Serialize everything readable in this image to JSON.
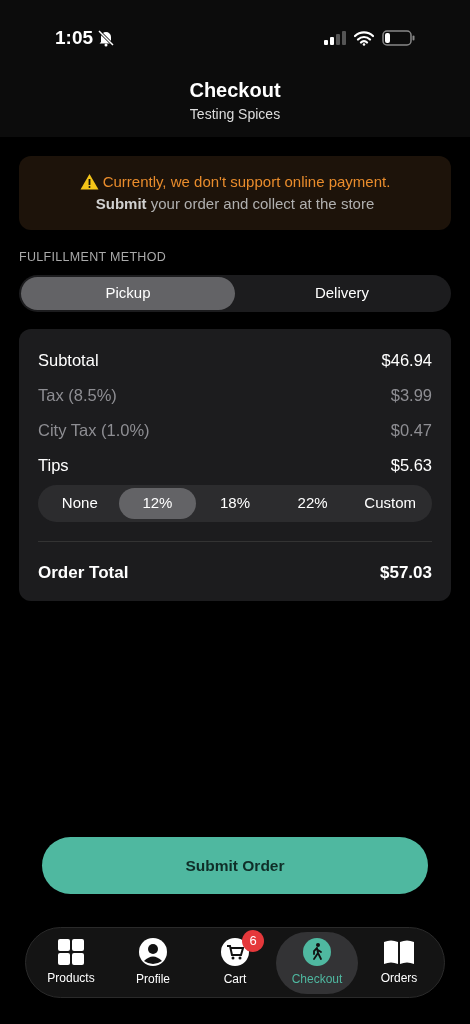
{
  "status_bar": {
    "time": "1:05",
    "silent": true
  },
  "header": {
    "title": "Checkout",
    "subtitle": "Testing Spices"
  },
  "notice": {
    "headline": "Currently, we don't support online payment.",
    "detail": "**Submit** your order and collect at the store"
  },
  "fulfillment": {
    "label": "FULFILLMENT METHOD",
    "options": [
      {
        "label": "Pickup",
        "selected": true
      },
      {
        "label": "Delivery",
        "selected": false
      }
    ]
  },
  "summary": {
    "rows": [
      {
        "label": "Subtotal",
        "value": "$46.94",
        "muted": false
      },
      {
        "label": "Tax (8.5%)",
        "value": "$3.99",
        "muted": true
      },
      {
        "label": "City Tax (1.0%)",
        "value": "$0.47",
        "muted": true
      },
      {
        "label": "Tips",
        "value": "$5.63",
        "muted": false
      }
    ],
    "tip_options": [
      {
        "label": "None",
        "selected": false
      },
      {
        "label": "12%",
        "selected": true
      },
      {
        "label": "18%",
        "selected": false
      },
      {
        "label": "22%",
        "selected": false
      },
      {
        "label": "Custom",
        "selected": false
      }
    ],
    "total": {
      "label": "Order Total",
      "value": "$57.03"
    }
  },
  "submit_button": "Submit Order",
  "tab_bar": [
    {
      "kind": "grid",
      "label": "Products",
      "selected": false
    },
    {
      "kind": "person",
      "label": "Profile",
      "selected": false
    },
    {
      "kind": "cart",
      "label": "Cart",
      "selected": false,
      "badge": "6"
    },
    {
      "kind": "walk",
      "label": "Checkout",
      "selected": true
    },
    {
      "kind": "book",
      "label": "Orders",
      "selected": false
    }
  ]
}
